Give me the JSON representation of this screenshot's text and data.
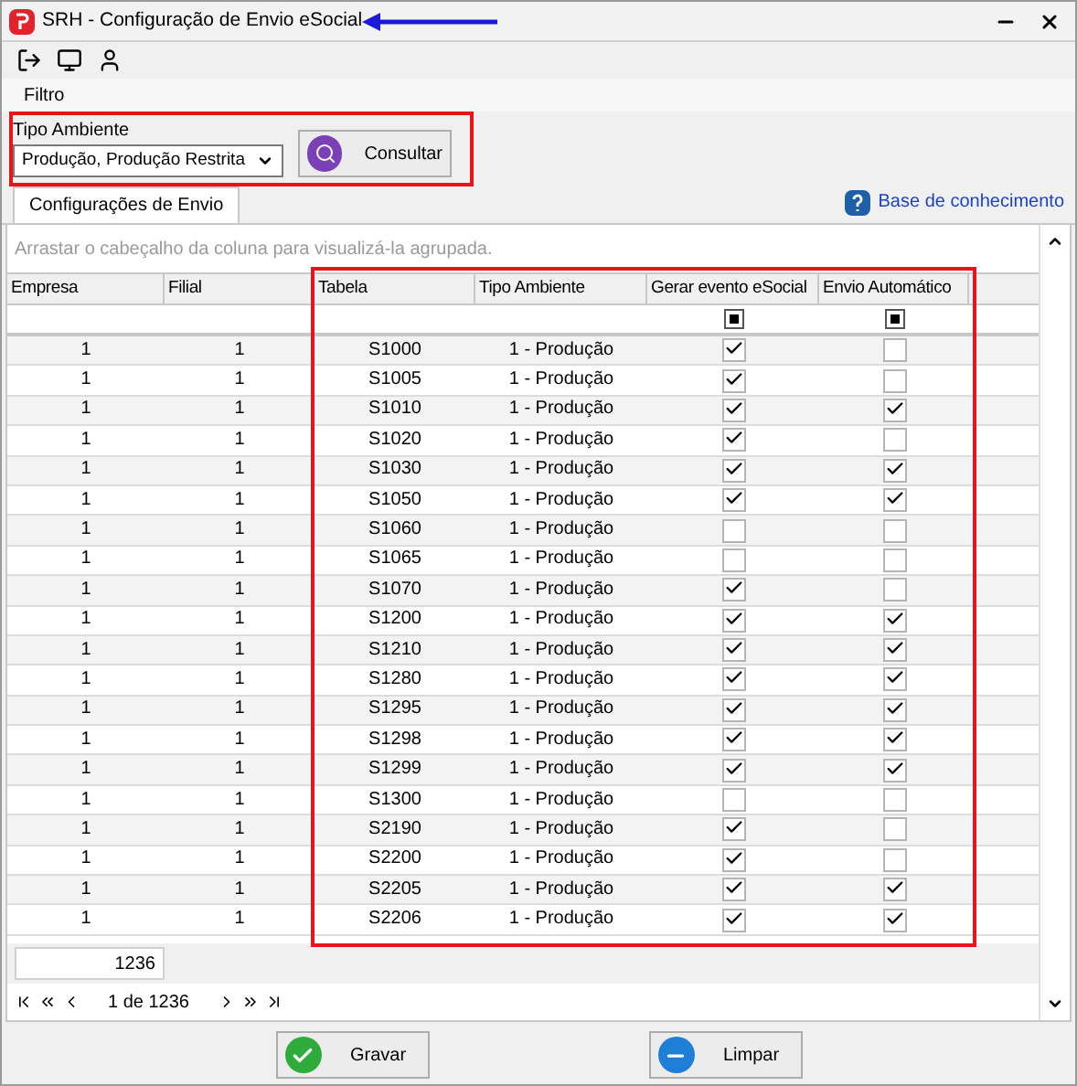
{
  "window": {
    "title": "SRH - Configuração de Envio eSocial"
  },
  "menu": {
    "label": "Filtro"
  },
  "filter": {
    "label": "Tipo Ambiente",
    "value": "Produção, Produção Restrita",
    "button": "Consultar"
  },
  "tabs": [
    {
      "label": "Configurações de Envio",
      "selected": true
    }
  ],
  "help_link": "Base de conhecimento",
  "grid": {
    "group_hint": "Arrastar o cabeçalho da coluna para visualizá-la agrupada.",
    "columns": [
      "Empresa",
      "Filial",
      "Tabela",
      "Tipo Ambiente",
      "Gerar evento eSocial",
      "Envio Automático"
    ],
    "rows": [
      {
        "empresa": "1",
        "filial": "1",
        "tabela": "S1000",
        "tipo": "1 - Produção",
        "gerar": true,
        "envio": false
      },
      {
        "empresa": "1",
        "filial": "1",
        "tabela": "S1005",
        "tipo": "1 - Produção",
        "gerar": true,
        "envio": false
      },
      {
        "empresa": "1",
        "filial": "1",
        "tabela": "S1010",
        "tipo": "1 - Produção",
        "gerar": true,
        "envio": true
      },
      {
        "empresa": "1",
        "filial": "1",
        "tabela": "S1020",
        "tipo": "1 - Produção",
        "gerar": true,
        "envio": false
      },
      {
        "empresa": "1",
        "filial": "1",
        "tabela": "S1030",
        "tipo": "1 - Produção",
        "gerar": true,
        "envio": true
      },
      {
        "empresa": "1",
        "filial": "1",
        "tabela": "S1050",
        "tipo": "1 - Produção",
        "gerar": true,
        "envio": true
      },
      {
        "empresa": "1",
        "filial": "1",
        "tabela": "S1060",
        "tipo": "1 - Produção",
        "gerar": false,
        "envio": false
      },
      {
        "empresa": "1",
        "filial": "1",
        "tabela": "S1065",
        "tipo": "1 - Produção",
        "gerar": false,
        "envio": false
      },
      {
        "empresa": "1",
        "filial": "1",
        "tabela": "S1070",
        "tipo": "1 - Produção",
        "gerar": true,
        "envio": false
      },
      {
        "empresa": "1",
        "filial": "1",
        "tabela": "S1200",
        "tipo": "1 - Produção",
        "gerar": true,
        "envio": true
      },
      {
        "empresa": "1",
        "filial": "1",
        "tabela": "S1210",
        "tipo": "1 - Produção",
        "gerar": true,
        "envio": true
      },
      {
        "empresa": "1",
        "filial": "1",
        "tabela": "S1280",
        "tipo": "1 - Produção",
        "gerar": true,
        "envio": true
      },
      {
        "empresa": "1",
        "filial": "1",
        "tabela": "S1295",
        "tipo": "1 - Produção",
        "gerar": true,
        "envio": true
      },
      {
        "empresa": "1",
        "filial": "1",
        "tabela": "S1298",
        "tipo": "1 - Produção",
        "gerar": true,
        "envio": true
      },
      {
        "empresa": "1",
        "filial": "1",
        "tabela": "S1299",
        "tipo": "1 - Produção",
        "gerar": true,
        "envio": true
      },
      {
        "empresa": "1",
        "filial": "1",
        "tabela": "S1300",
        "tipo": "1 - Produção",
        "gerar": false,
        "envio": false
      },
      {
        "empresa": "1",
        "filial": "1",
        "tabela": "S2190",
        "tipo": "1 - Produção",
        "gerar": true,
        "envio": false
      },
      {
        "empresa": "1",
        "filial": "1",
        "tabela": "S2200",
        "tipo": "1 - Produção",
        "gerar": true,
        "envio": false
      },
      {
        "empresa": "1",
        "filial": "1",
        "tabela": "S2205",
        "tipo": "1 - Produção",
        "gerar": true,
        "envio": true
      },
      {
        "empresa": "1",
        "filial": "1",
        "tabela": "S2206",
        "tipo": "1 - Produção",
        "gerar": true,
        "envio": true
      }
    ],
    "filter_checks": [
      {
        "indeterminate": true
      },
      {
        "indeterminate": true
      }
    ],
    "footer_count": "1236",
    "pager": "1 de 1236"
  },
  "buttons": [
    {
      "label": "Gravar",
      "kind": "save"
    },
    {
      "label": "Limpar",
      "kind": "clear"
    }
  ]
}
